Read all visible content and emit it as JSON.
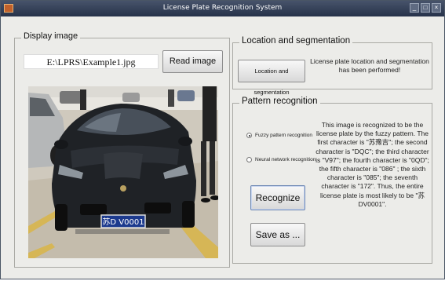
{
  "window": {
    "title": "License Plate Recognition System"
  },
  "display": {
    "group_label": "Display image",
    "file_path": "E:\\LPRS\\Example1.jpg",
    "read_button": "Read image",
    "plate_text": "苏D V0001"
  },
  "location": {
    "group_label": "Location and segmentation",
    "button_label": "Location and segmentation",
    "status": "License plate location and segmentation has been performed!"
  },
  "recognition": {
    "group_label": "Pattern recognition",
    "options": [
      {
        "label": "Fuzzy pattern recognition",
        "selected": true
      },
      {
        "label": "Neural network recognition",
        "selected": false
      }
    ],
    "recognize_button": "Recognize",
    "save_button": "Save as ...",
    "result_text": "This image is recognized to be the license plate by the fuzzy pattern. The first character is \"苏豫吉\"; the second character is \"DQC\"; the third character is \"V97\"; the fourth character is \"0QD\"; the fifth character is  \"086\" ; the sixth character is \"085\"; the seventh character is \"172\". Thus, the entire license plate is most likely to be \"苏DV0001\"."
  }
}
